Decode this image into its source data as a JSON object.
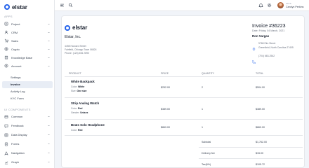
{
  "brand": {
    "name": "elstar"
  },
  "sidebar": {
    "apps_title": "APPS",
    "apps": [
      {
        "label": "Project",
        "icon": "project-icon"
      },
      {
        "label": "CRM",
        "icon": "crm-icon"
      },
      {
        "label": "Sales",
        "icon": "sales-icon"
      },
      {
        "label": "Crypto",
        "icon": "crypto-icon"
      },
      {
        "label": "Knowledge Base",
        "icon": "knowledge-icon"
      },
      {
        "label": "Account",
        "icon": "account-icon"
      }
    ],
    "account_sub": [
      "Settings",
      "Invoice",
      "Activity Log",
      "KYC Form"
    ],
    "ui_title": "UI COMPONENTS",
    "ui": [
      {
        "label": "Common",
        "icon": "common-icon"
      },
      {
        "label": "Feedback",
        "icon": "feedback-icon"
      },
      {
        "label": "Data Display",
        "icon": "data-display-icon"
      },
      {
        "label": "Forms",
        "icon": "forms-icon"
      },
      {
        "label": "Navigation",
        "icon": "navigation-icon"
      },
      {
        "label": "Graph",
        "icon": "graph-icon"
      }
    ]
  },
  "header": {
    "user_role": "admin",
    "user_name": "Carolyn Perkins",
    "icons": [
      "menu-icon",
      "search-icon",
      "us-flag-icon",
      "bell-icon",
      "settings-icon"
    ]
  },
  "invoice": {
    "company": "Elstar, Inc.",
    "company_address": [
      "4498 Harvard Street",
      "Fairfield, Chicago Town 06824",
      "Phone: (123) 456-7890"
    ],
    "title": "Invoice #36223",
    "date": "Date: Friday, 04 March, 2021",
    "bill_name": "Ron Vargas",
    "bill_address": [
      "9768 Elm Street",
      "Greenfield, North Carolina 27405"
    ],
    "bill_phone": "(704) 663-2542",
    "columns": [
      "PRODUCT",
      "PRICE",
      "QUANTITY",
      "TOTAL"
    ],
    "items": [
      {
        "name": "White Backpack",
        "attr1_label": "Color:",
        "attr1_value": "White",
        "attr2_label": "Size:",
        "attr2_value": "One size",
        "price": "$252.00",
        "qty": "2",
        "total": "$504.00"
      },
      {
        "name": "Strip Analog Watch",
        "attr1_label": "Color:",
        "attr1_value": "Red",
        "attr2_label": "Gender:",
        "attr2_value": "Unisex",
        "price": "$389.00",
        "qty": "1",
        "total": "$389.00"
      },
      {
        "name": "Beats Solo Headphone",
        "attr1_label": "Color:",
        "attr1_value": "Red",
        "attr2_label": "",
        "attr2_value": "",
        "price": "$869.00",
        "qty": "1",
        "total": "$869.00"
      }
    ],
    "summary": [
      {
        "label": "Subtotal",
        "value": "$1,762.00"
      },
      {
        "label": "Delivery fee",
        "value": "$15.00"
      },
      {
        "label": "Tax(6%)",
        "value": "$105.72"
      }
    ]
  },
  "colors": {
    "accent": "#2563eb",
    "active_bg": "#e8edf5"
  }
}
